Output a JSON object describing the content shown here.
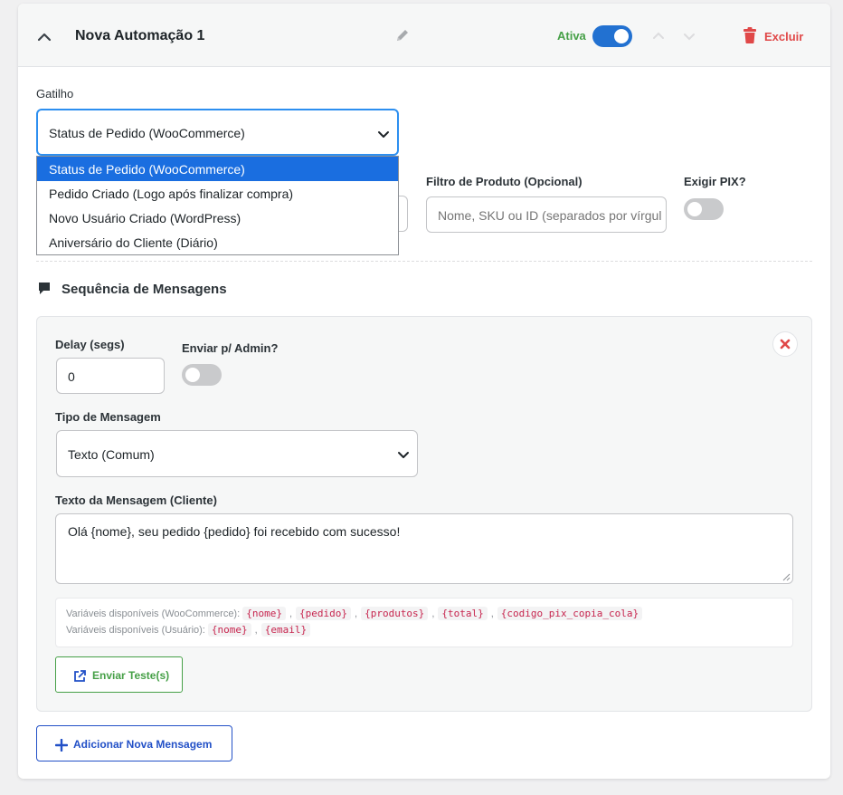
{
  "header": {
    "title": "Nova Automação 1",
    "status_label": "Ativa",
    "status_on": true,
    "delete_label": "Excluir"
  },
  "trigger": {
    "label": "Gatilho",
    "selected": "Status de Pedido (WooCommerce)",
    "options": [
      "Status de Pedido (WooCommerce)",
      "Pedido Criado (Logo após finalizar compra)",
      "Novo Usuário Criado (WordPress)",
      "Aniversário do Cliente (Diário)"
    ]
  },
  "product_filter": {
    "label": "Filtro de Produto (Opcional)",
    "placeholder": "Nome, SKU ou ID (separados por vírgula)"
  },
  "require_pix": {
    "label": "Exigir PIX?",
    "on": false
  },
  "sequence": {
    "title": "Sequência de Mensagens",
    "message": {
      "delay_label": "Delay (segs)",
      "delay_value": "0",
      "send_admin_label": "Enviar p/ Admin?",
      "send_admin_on": false,
      "type_label": "Tipo de Mensagem",
      "type_value": "Texto (Comum)",
      "text_label": "Texto da Mensagem (Cliente)",
      "text_value": "Olá {nome}, seu pedido {pedido} foi recebido com sucesso!",
      "vars_woo_label": "Variáveis disponíveis (WooCommerce):",
      "vars_woo": [
        "{nome}",
        "{pedido}",
        "{produtos}",
        "{total}",
        "{codigo_pix_copia_cola}"
      ],
      "vars_user_label": "Variáveis disponíveis (Usuário):",
      "vars_user": [
        "{nome}",
        "{email}"
      ],
      "test_button": "Enviar Teste(s)"
    },
    "add_button": "Adicionar Nova Mensagem"
  },
  "colors": {
    "accent_blue": "#2271d1",
    "success_green": "#46a047",
    "danger_red": "#e04848",
    "dropdown_highlight": "#1a6ee0"
  }
}
